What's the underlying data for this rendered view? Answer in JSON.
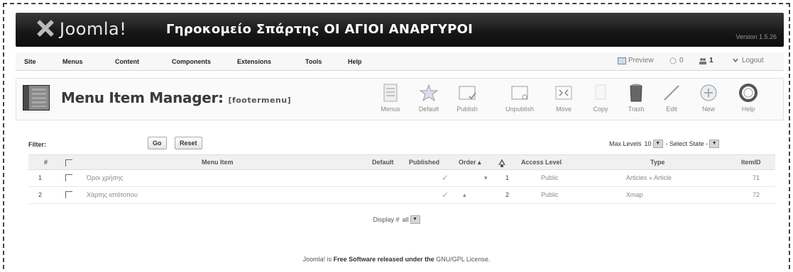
{
  "header": {
    "brand": "Joomla!",
    "site_name": "Γηροκομείο Σπάρτης ΟΙ ΑΓΙΟΙ ΑΝΑΡΓΥΡΟΙ",
    "version": "Version 1.5.26"
  },
  "menubar": {
    "items": [
      "Site",
      "Menus",
      "Content",
      "Components",
      "Extensions",
      "Tools",
      "Help"
    ],
    "preview": "Preview",
    "messages_count": "0",
    "users_count": "1",
    "logout": "Logout"
  },
  "toolbar": {
    "title": "Menu Item Manager:",
    "subtitle": "[footermenu]",
    "buttons": [
      "Menus",
      "Default",
      "Publish",
      "Unpublish",
      "Move",
      "Copy",
      "Trash",
      "Edit",
      "New",
      "Help"
    ]
  },
  "filter": {
    "label": "Filter:",
    "value": "",
    "go": "Go",
    "reset": "Reset",
    "max_levels_label": "Max Levels",
    "max_levels_value": "10",
    "state_select": "- Select State -"
  },
  "table": {
    "headers": {
      "num": "#",
      "item": "Menu Item",
      "default": "Default",
      "published": "Published",
      "order": "Order",
      "access": "Access Level",
      "type": "Type",
      "itemid": "ItemID"
    },
    "rows": [
      {
        "num": "1",
        "name": "Όροι χρήσης",
        "published": "✓",
        "order_arrow": "▾",
        "order": "1",
        "access": "Public",
        "type": "Articles » Article",
        "itemid": "71"
      },
      {
        "num": "2",
        "name": "Χάρτης ιστότοπου",
        "published": "✓",
        "order_arrow": "▴",
        "order": "2",
        "access": "Public",
        "type": "Xmap",
        "itemid": "72"
      }
    ]
  },
  "display": {
    "label": "Display #",
    "value": "all"
  },
  "footer": {
    "prefix": "Joomla! is",
    "bold": "Free Software released under the",
    "suffix": "GNU/GPL License."
  }
}
